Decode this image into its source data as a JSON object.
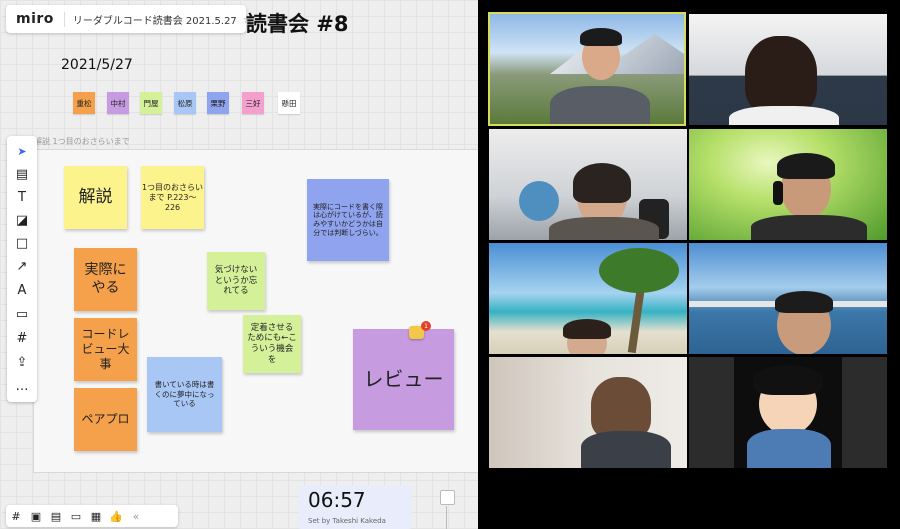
{
  "app": {
    "logo": "miro",
    "board_name": "リーダブルコード読書会 2021.5.27",
    "star": "☆"
  },
  "board": {
    "title": "読書会 #8",
    "date": "2021/5/27",
    "frame_label": "解説 1つ目のおさらいまで",
    "participants": [
      {
        "name": "重松",
        "color": "#f5a04a"
      },
      {
        "name": "中村",
        "color": "#c79be0"
      },
      {
        "name": "門屋",
        "color": "#d4f19a"
      },
      {
        "name": "松原",
        "color": "#a8c7f5"
      },
      {
        "name": "栗野",
        "color": "#8fa3ee"
      },
      {
        "name": "三好",
        "color": "#f3a0cf"
      },
      {
        "name": "懸田",
        "color": "#ffffff"
      }
    ],
    "notes": {
      "kaisetsu": "解説",
      "osarai": "1つ目のおさらいまで P.223〜226",
      "jissai_code": "実際にコードを書く際は心がけているが、読みやすいかどうかは自分では判断しづらい。",
      "jissai_yaru": "実際にやる",
      "kizukenai": "気づけないというか忘れてる",
      "code_review": "コードレビュー大事",
      "teiki": "定着させるためにも←こういう機会を",
      "kaiteiru": "書いている時は書くのに夢中になっている",
      "review": "レビュー",
      "pairpro": "ペアプロ",
      "comment_count": "1"
    }
  },
  "toolbar": {
    "tools": [
      "select-tool",
      "templates-tool",
      "text-tool",
      "sticky-note-tool",
      "shape-tool",
      "arrow-tool",
      "pen-tool",
      "comment-tool",
      "frame-tool",
      "upload-tool",
      "more-tool"
    ],
    "glyphs": [
      "➤",
      "▤",
      "T",
      "◪",
      "□",
      "↗",
      "A",
      "▭",
      "#",
      "⇪",
      "…"
    ]
  },
  "bottom_toolbar": {
    "glyphs": [
      "#",
      "▣",
      "▤",
      "▭",
      "▦",
      "👍",
      "«"
    ]
  },
  "timer": {
    "value": "06:57",
    "set_by": "Set by Takeshi Kakeda"
  },
  "video": {
    "colors": {
      "active_border": "#d7dd5b",
      "background": "#000000"
    }
  }
}
